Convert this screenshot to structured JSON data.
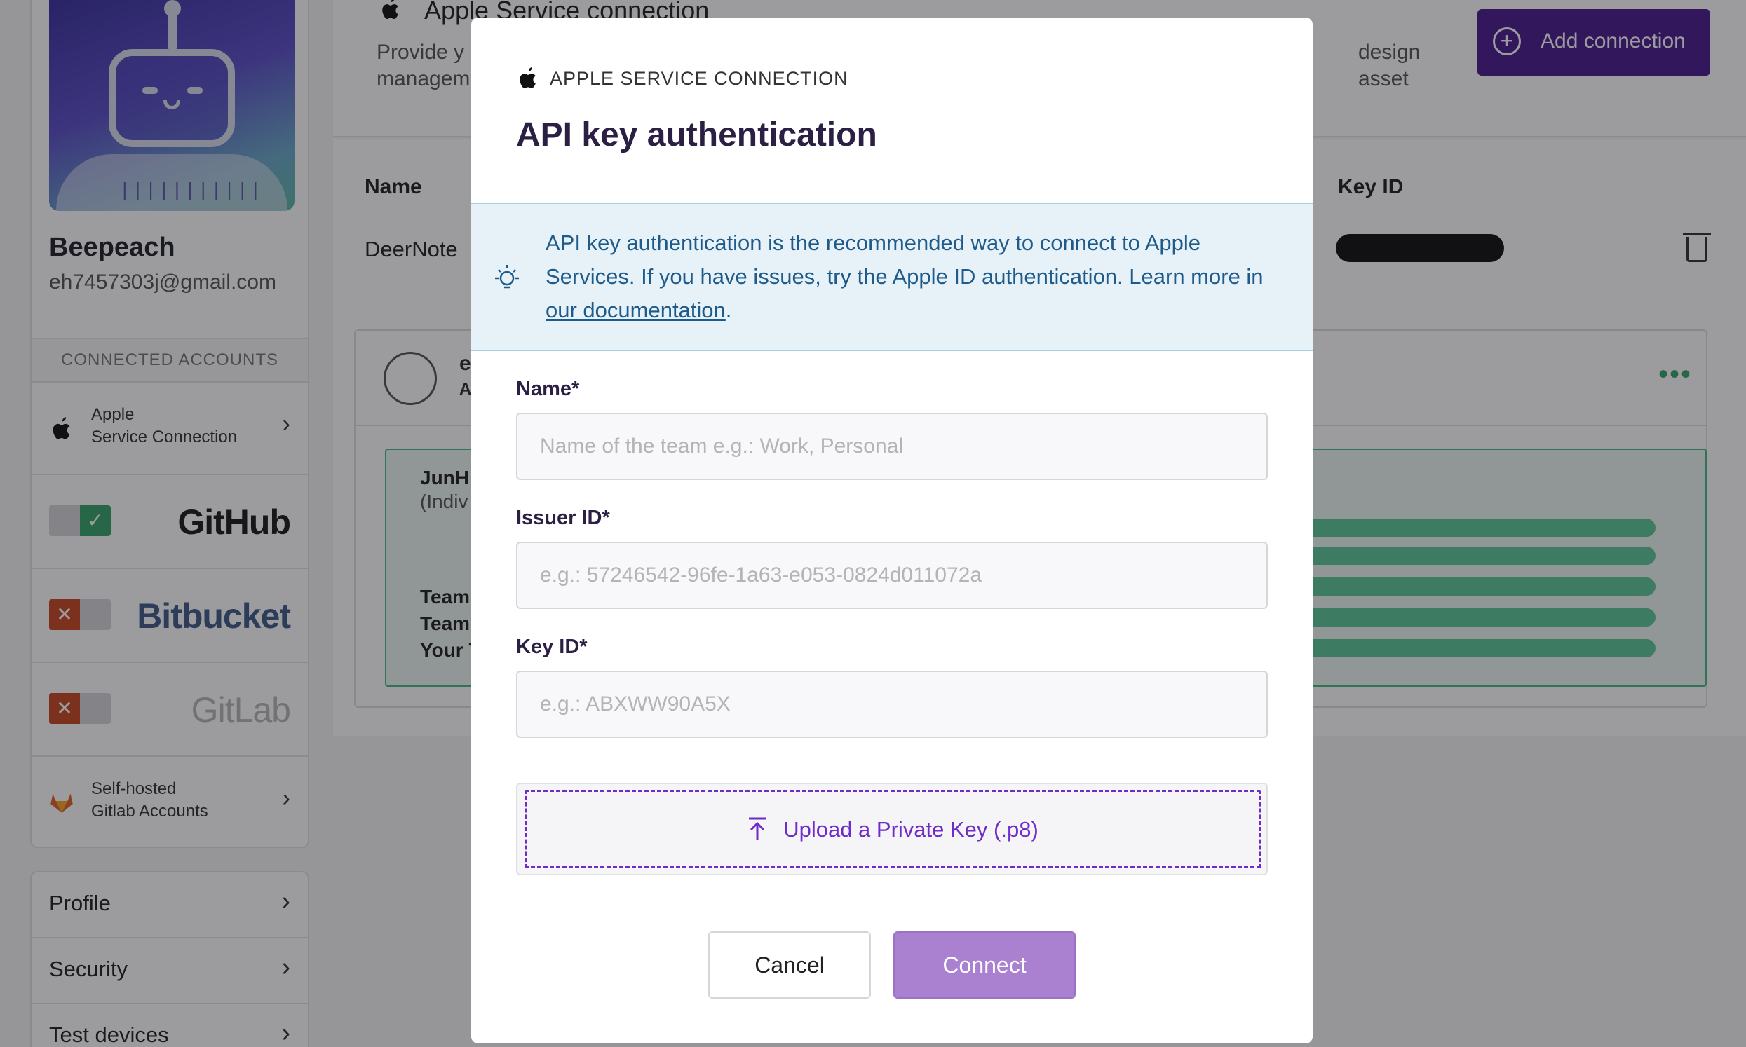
{
  "sidebar": {
    "user_name": "Beepeach",
    "user_email": "eh7457303j@gmail.com",
    "connected_accounts_heading": "CONNECTED ACCOUNTS",
    "apple": {
      "line1": "Apple",
      "line2": "Service Connection"
    },
    "github": {
      "label": "GitHub",
      "enabled": true
    },
    "bitbucket": {
      "label": "Bitbucket",
      "enabled": false
    },
    "gitlab": {
      "label": "GitLab",
      "enabled": false
    },
    "selfhosted": {
      "line1": "Self-hosted",
      "line2": "Gitlab Accounts"
    },
    "menu": [
      {
        "label": "Profile"
      },
      {
        "label": "Security"
      },
      {
        "label": "Test devices"
      }
    ]
  },
  "main": {
    "title": "Apple Service connection",
    "description_start": "Provide y",
    "description_start2": "managem",
    "description_end": "design asset",
    "add_button": "Add connection",
    "columns": {
      "name": "Name",
      "key_id": "Key ID"
    },
    "row_name": "DeerNote",
    "team_initial": "e",
    "team_sub": "A",
    "green_lines": [
      "JunH",
      "(Indiv",
      "Team",
      "Team",
      "Your T"
    ]
  },
  "modal": {
    "eyebrow": "APPLE SERVICE CONNECTION",
    "title": "API key authentication",
    "info_text": "API key authentication is the recommended way to connect to Apple Services. If you have issues, try the Apple ID authentication. Learn more in ",
    "info_link": "our documentation",
    "info_end": ".",
    "fields": {
      "name_label": "Name*",
      "name_placeholder": "Name of the team e.g.: Work, Personal",
      "name_value": "",
      "issuer_label": "Issuer ID*",
      "issuer_placeholder": "e.g.: 57246542-96fe-1a63-e053-0824d011072a",
      "issuer_value": "",
      "keyid_label": "Key ID*",
      "keyid_placeholder": "e.g.: ABXWW90A5X",
      "keyid_value": ""
    },
    "upload_label": "Upload a Private Key (.p8)",
    "cancel": "Cancel",
    "connect": "Connect"
  },
  "colors": {
    "brand_purple": "#4b1a8f",
    "upload_purple": "#6f2cc9",
    "connect_disabled": "#a981d0",
    "info_bg": "#e7f1f8",
    "info_text": "#1e5a8a",
    "success_green": "#36a36a",
    "error_red": "#c64723"
  },
  "icons": {
    "apple": "apple-logo-icon",
    "bulb": "lightbulb-icon",
    "upload": "upload-arrow-icon",
    "trash": "trash-icon",
    "chevron": "chevron-right-icon"
  }
}
